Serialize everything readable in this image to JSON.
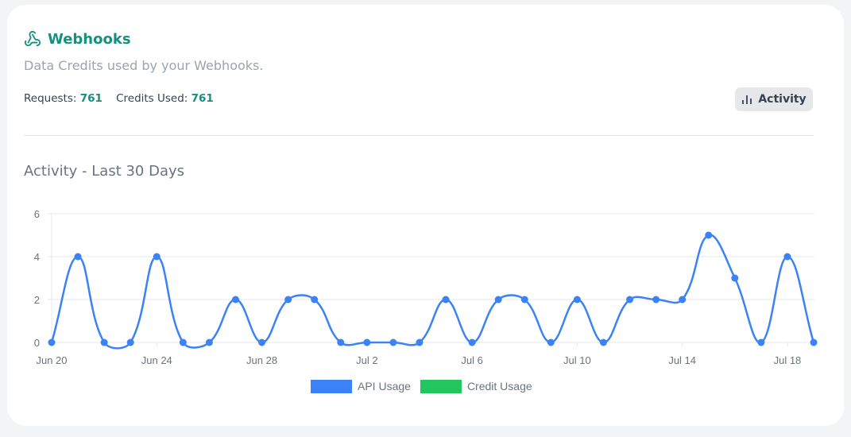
{
  "header": {
    "title": "Webhooks",
    "icon": "webhook-icon",
    "subtitle": "Data Credits used by your Webhooks."
  },
  "stats": {
    "requests_label": "Requests:",
    "requests": "761",
    "credits_label": "Credits Used:",
    "credits": "761"
  },
  "activity_button": {
    "label": "Activity",
    "icon": "bar-chart-icon"
  },
  "colors": {
    "accent": "#16917f",
    "api": "#3b82f6",
    "credit": "#22c55e"
  },
  "chart_data": {
    "type": "line",
    "title": "Activity - Last 30 Days",
    "x": [
      "Jun 20",
      "Jun 21",
      "Jun 22",
      "Jun 23",
      "Jun 24",
      "Jun 25",
      "Jun 26",
      "Jun 27",
      "Jun 28",
      "Jun 29",
      "Jun 30",
      "Jul 1",
      "Jul 2",
      "Jul 3",
      "Jul 4",
      "Jul 5",
      "Jul 6",
      "Jul 7",
      "Jul 8",
      "Jul 9",
      "Jul 10",
      "Jul 11",
      "Jul 12",
      "Jul 13",
      "Jul 14",
      "Jul 15",
      "Jul 16",
      "Jul 17",
      "Jul 18",
      "Jul 19"
    ],
    "xticks": [
      "Jun 20",
      "Jun 24",
      "Jun 28",
      "Jul 2",
      "Jul 6",
      "Jul 10",
      "Jul 14",
      "Jul 18"
    ],
    "yticks": [
      "0",
      "2",
      "4",
      "6"
    ],
    "ylim": [
      0,
      6
    ],
    "grid": true,
    "legend": "bottom",
    "series": [
      {
        "name": "API Usage",
        "color": "#3b82f6",
        "values": [
          0,
          4,
          0,
          0,
          4,
          0,
          0,
          2,
          0,
          2,
          2,
          0,
          0,
          0,
          0,
          2,
          0,
          2,
          2,
          0,
          2,
          0,
          2,
          2,
          2,
          5,
          3,
          0,
          4,
          0
        ]
      },
      {
        "name": "Credit Usage",
        "color": "#22c55e",
        "values": []
      }
    ]
  }
}
